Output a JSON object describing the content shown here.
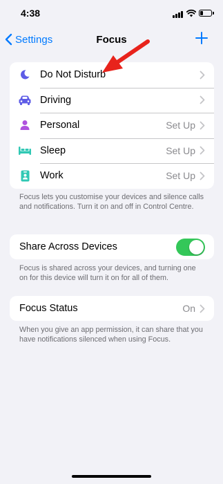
{
  "status_bar": {
    "time": "4:38",
    "icons": [
      "signal-icon",
      "wifi-icon",
      "battery-icon"
    ]
  },
  "nav": {
    "back_label": "Settings",
    "title": "Focus",
    "add_icon": "plus-icon"
  },
  "focus_modes": [
    {
      "label": "Do Not Disturb",
      "value": "",
      "icon": "moon-icon",
      "color": "#5e5ce6"
    },
    {
      "label": "Driving",
      "value": "",
      "icon": "car-icon",
      "color": "#5e5ce6"
    },
    {
      "label": "Personal",
      "value": "Set Up",
      "icon": "person-icon",
      "color": "#af52de"
    },
    {
      "label": "Sleep",
      "value": "Set Up",
      "icon": "bed-icon",
      "color": "#30c8b4"
    },
    {
      "label": "Work",
      "value": "Set Up",
      "icon": "badge-icon",
      "color": "#30c8b4"
    }
  ],
  "focus_footer": "Focus lets you customise your devices and silence calls and notifications. Turn it on and off in Control Centre.",
  "share": {
    "label": "Share Across Devices",
    "enabled": true,
    "footer": "Focus is shared across your devices, and turning one on for this device will turn it on for all of them."
  },
  "focus_status": {
    "label": "Focus Status",
    "value": "On",
    "footer": "When you give an app permission, it can share that you have notifications silenced when using Focus."
  },
  "colors": {
    "accent": "#007aff",
    "toggle_on": "#34c759",
    "annotation_arrow": "#e8231c"
  }
}
